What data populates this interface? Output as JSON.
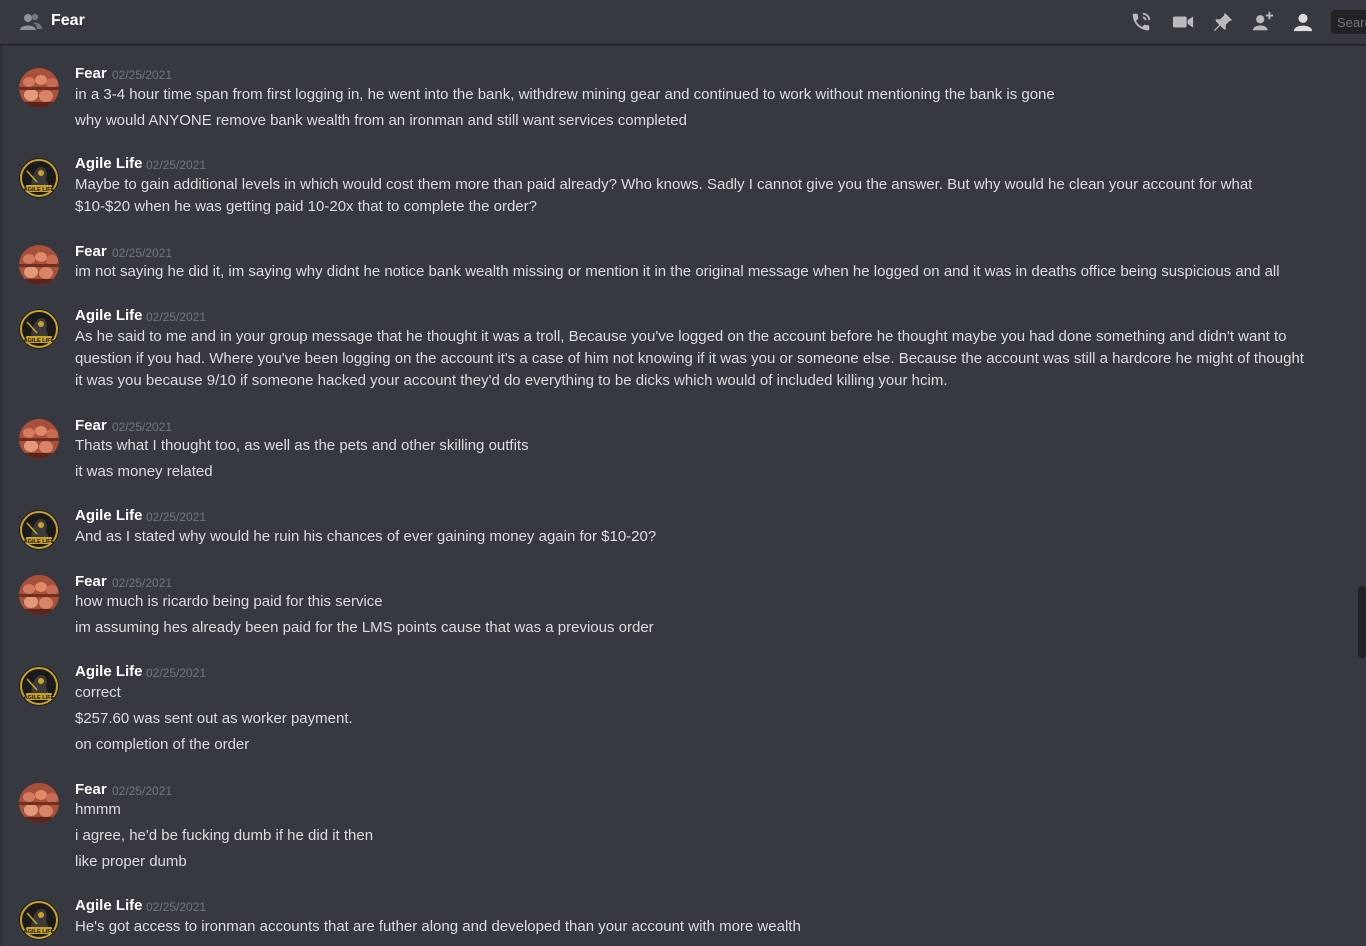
{
  "header": {
    "title": "Fear",
    "icons": [
      "people-icon",
      "call-icon",
      "video-icon",
      "pin-icon",
      "add-member-icon",
      "member-list-icon"
    ],
    "search_placeholder": "Search"
  },
  "messages": [
    {
      "author": "Fear",
      "time": "02/25/2021",
      "lines": [
        "in a 3-4 hour time span from first logging in, he went into the bank, withdrew mining gear and continued to work without mentioning the bank is gone",
        "why would ANYONE remove bank wealth from an ironman and still want services completed"
      ]
    },
    {
      "author": "Agile Life",
      "time": "02/25/2021",
      "lines": [
        "Maybe to gain additional levels in which would cost them more than paid already? Who knows. Sadly I cannot give you the answer. But why would he clean your account for what",
        "$10-$20 when he was getting paid 10-20x that to complete the order?"
      ]
    },
    {
      "author": "Fear",
      "time": "02/25/2021",
      "lines": [
        "im not saying he did it, im saying why didnt he notice bank wealth missing or mention it in the original message when he logged on and it was in deaths office being suspicious and all"
      ]
    },
    {
      "author": "Agile Life",
      "time": "02/25/2021",
      "lines": [
        "As he said to me and in your group message that he thought it was a troll, Because you've logged on the account before he thought maybe you had done something and didn't want to",
        "question if you had. Where you've been logging on the account it's a case of him not knowing if it was you or someone else. Because the account was still a hardcore he might of thought",
        "it was you because 9/10 if someone hacked your account they'd do everything to be dicks which would of included killing your hcim."
      ]
    },
    {
      "author": "Fear",
      "time": "02/25/2021",
      "lines": [
        "Thats what I thought too, as well as the pets and other skilling outfits",
        "it was money related"
      ]
    },
    {
      "author": "Agile Life",
      "time": "02/25/2021",
      "lines": [
        "And as I stated why would he ruin his chances of ever gaining money again for $10-20?"
      ]
    },
    {
      "author": "Fear",
      "time": "02/25/2021",
      "lines": [
        "how much is ricardo being paid for this service",
        "im assuming hes already been paid for the LMS points cause that was a previous order"
      ]
    },
    {
      "author": "Agile Life",
      "time": "02/25/2021",
      "lines": [
        "correct",
        "$257.60 was sent out as worker payment.",
        "on completion of the order"
      ]
    },
    {
      "author": "Fear",
      "time": "02/25/2021",
      "lines": [
        "hmmm",
        "i agree, he'd be fucking dumb if he did it then",
        "like proper dumb"
      ]
    },
    {
      "author": "Agile Life",
      "time": "02/25/2021",
      "lines": [
        "He's got access to ironman accounts that are futher along and developed than your account with more wealth"
      ]
    }
  ]
}
